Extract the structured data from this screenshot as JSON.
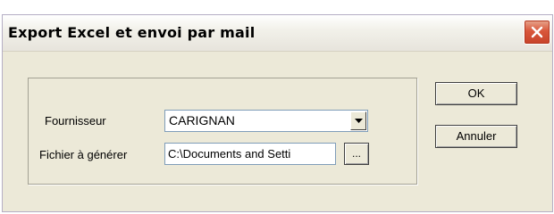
{
  "window": {
    "title": "Export Excel et envoi par mail",
    "close_icon": "close-icon"
  },
  "form": {
    "fournisseur_label": "Fournisseur",
    "fournisseur_value": "CARIGNAN",
    "fichier_label": "Fichier à générer",
    "fichier_value": "C:\\Documents and Setti",
    "browse_label": "..."
  },
  "buttons": {
    "ok_label": "OK",
    "annuler_label": "Annuler"
  },
  "colors": {
    "dialog_bg": "#ece9d8",
    "close_button": "#d9573b",
    "input_border": "#7f9db9"
  }
}
